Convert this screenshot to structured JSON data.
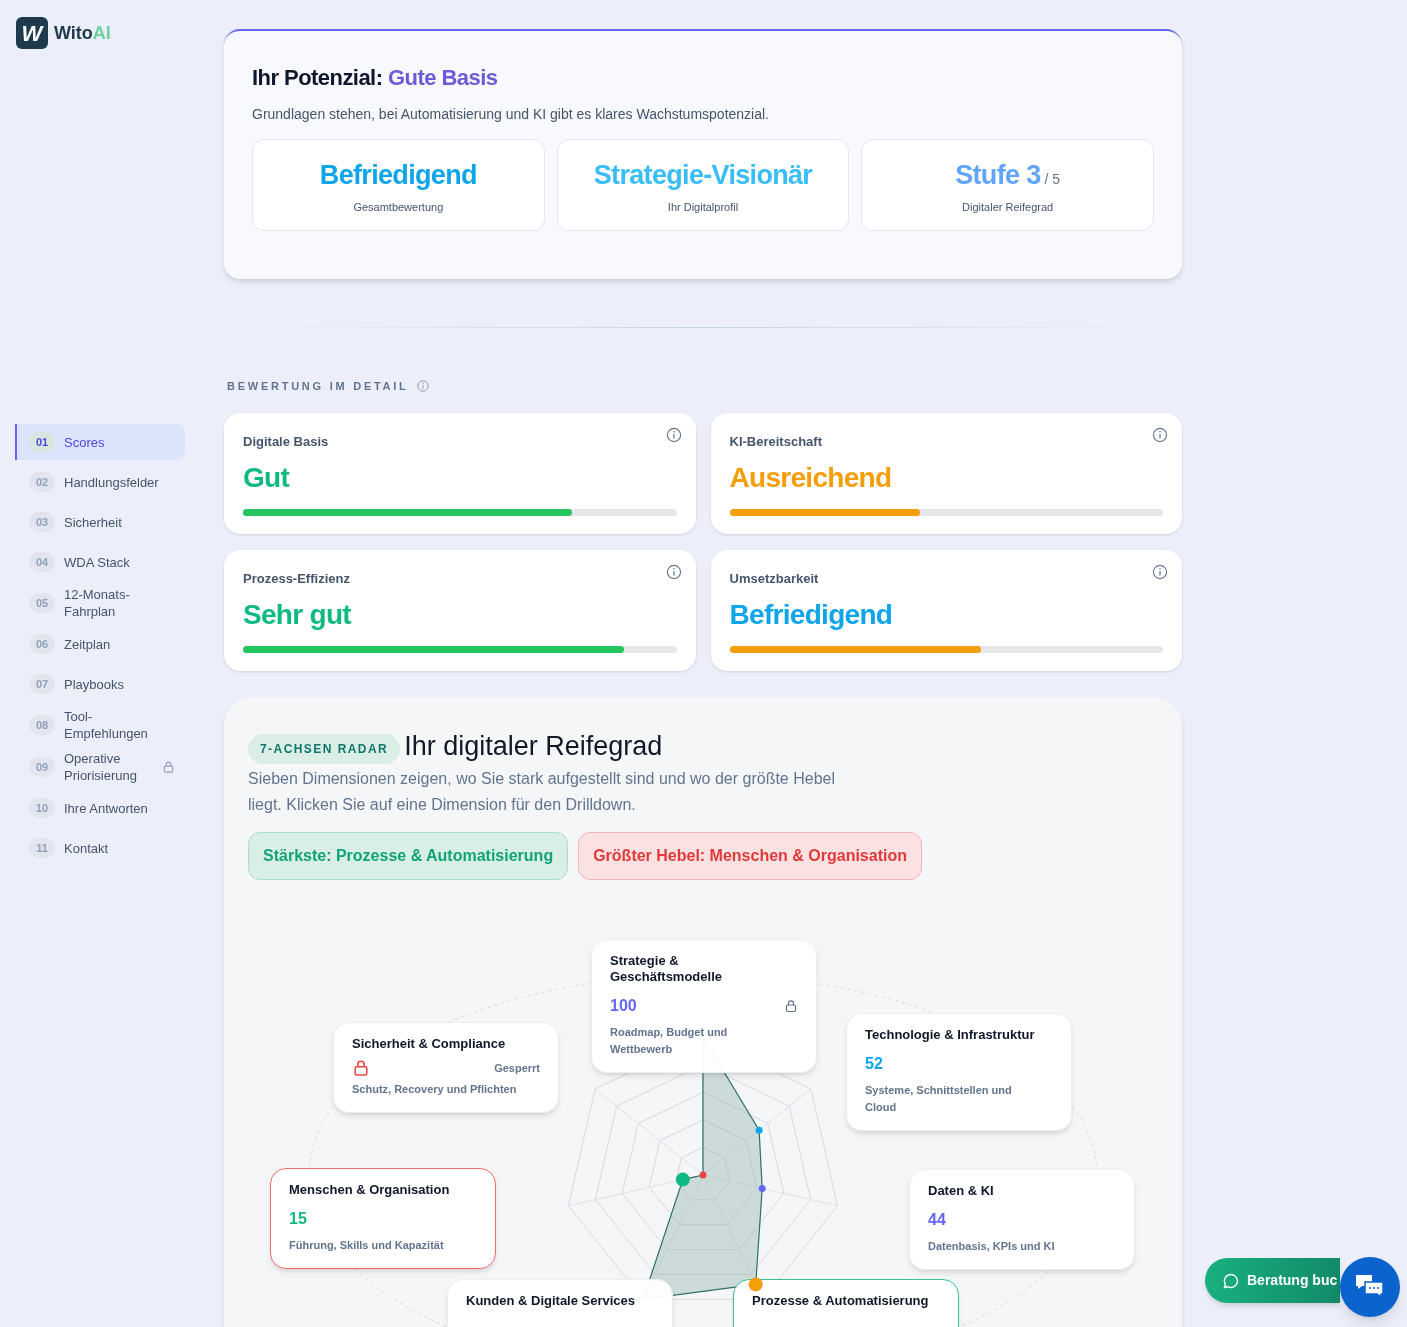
{
  "brand": {
    "logo_letter": "W",
    "name_main": "Wito",
    "name_accent": "AI"
  },
  "sidebar": {
    "items": [
      {
        "number": "01",
        "label": "Scores",
        "selected": true,
        "locked": false
      },
      {
        "number": "02",
        "label": "Handlungsfelder",
        "selected": false,
        "locked": false
      },
      {
        "number": "03",
        "label": "Sicherheit",
        "selected": false,
        "locked": false
      },
      {
        "number": "04",
        "label": "WDA Stack",
        "selected": false,
        "locked": false
      },
      {
        "number": "05",
        "label": "12-Monats-Fahrplan",
        "selected": false,
        "locked": false
      },
      {
        "number": "06",
        "label": "Zeitplan",
        "selected": false,
        "locked": false
      },
      {
        "number": "07",
        "label": "Playbooks",
        "selected": false,
        "locked": false
      },
      {
        "number": "08",
        "label": "Tool-Empfehlungen",
        "selected": false,
        "locked": false
      },
      {
        "number": "09",
        "label": "Operative Priorisierung",
        "selected": false,
        "locked": true
      },
      {
        "number": "10",
        "label": "Ihre Antworten",
        "selected": false,
        "locked": false
      },
      {
        "number": "11",
        "label": "Kontakt",
        "selected": false,
        "locked": false
      }
    ]
  },
  "summary": {
    "title": "Ihr Potenzial:",
    "title_accent": "Gute Basis",
    "subtitle": "Grundlagen stehen, bei Automatisierung und KI gibt es klares Wachstumspotenzial.",
    "tiles": [
      {
        "value": "Befriedigend",
        "label": "Gesamtbewertung",
        "color": "#0ea5e9"
      },
      {
        "value": "Strategie-Visionär",
        "label": "Ihr Digitalprofil",
        "color": "#38bdf8"
      },
      {
        "value": "Stufe 3",
        "suffix": "/ 5",
        "label": "Digitaler Reifegrad",
        "color": "#60a5fa"
      }
    ]
  },
  "details": {
    "heading": "BEWERTUNG IM DETAIL",
    "cards": [
      {
        "label": "Digitale Basis",
        "rating": {
          "text": "Gut",
          "color": "#10b981"
        },
        "bar": {
          "level": 0.76,
          "color": "#22c55e"
        }
      },
      {
        "label": "KI-Bereitschaft",
        "rating": {
          "text": "Ausreichend",
          "color": "#f59e0b"
        },
        "bar": {
          "level": 0.44,
          "color": "#f59e0b"
        }
      },
      {
        "label": "Prozess-Effizienz",
        "rating": {
          "text": "Sehr gut",
          "color": "#10b981"
        },
        "bar": {
          "level": 0.88,
          "color": "#22c55e"
        }
      },
      {
        "label": "Umsetzbarkeit",
        "rating": {
          "text": "Befriedigend",
          "color": "#0ea5e9"
        },
        "bar": {
          "level": 0.58,
          "color": "#f59e0b"
        }
      }
    ]
  },
  "radar": {
    "badge": "7-ACHSEN RADAR",
    "title": "Ihr digitaler Reifegrad",
    "description": "Sieben Dimensionen zeigen, wo Sie stark aufgestellt sind und wo der größte Hebel liegt. Klicken Sie auf eine Dimension für den Drilldown.",
    "pills": [
      {
        "kind": "strength",
        "text": "Stärkste: Prozesse & Automatisierung"
      },
      {
        "kind": "lever",
        "text": "Größter Hebel: Menschen & Organisation"
      }
    ],
    "nodes": [
      {
        "kind": "score",
        "title": "Strategie & Geschäftsmodelle",
        "score": "100",
        "color": "#6366f1",
        "description": "Roadmap, Budget und Wettbewerb",
        "locked": true,
        "weakest": false,
        "strongest": false
      },
      {
        "kind": "blocked",
        "title": "Sicherheit & Compliance",
        "status": "Gesperrt",
        "description": "Schutz, Recovery und Pflichten",
        "weakest": false,
        "strongest": false
      },
      {
        "kind": "score",
        "title": "Technologie & Infrastruktur",
        "score": "52",
        "color": "#0ea5e9",
        "description": "Systeme, Schnittstellen und Cloud",
        "locked": false,
        "weakest": false,
        "strongest": false
      },
      {
        "kind": "score",
        "title": "Menschen & Organisation",
        "score": "15",
        "color": "#10b981",
        "description": "Führung, Skills und Kapazität",
        "locked": false,
        "weakest": true,
        "strongest": false
      },
      {
        "kind": "score",
        "title": "Daten & KI",
        "score": "44",
        "color": "#6366f1",
        "description": "Datenbasis, KPIs und KI",
        "locked": false,
        "weakest": false,
        "strongest": false
      },
      {
        "kind": "title",
        "title": "Kunden & Digitale Services",
        "weakest": false,
        "strongest": false
      },
      {
        "kind": "title",
        "title": "Prozesse & Automatisierung",
        "weakest": false,
        "strongest": true
      }
    ]
  },
  "cta": {
    "text": "Beratung buc"
  }
}
